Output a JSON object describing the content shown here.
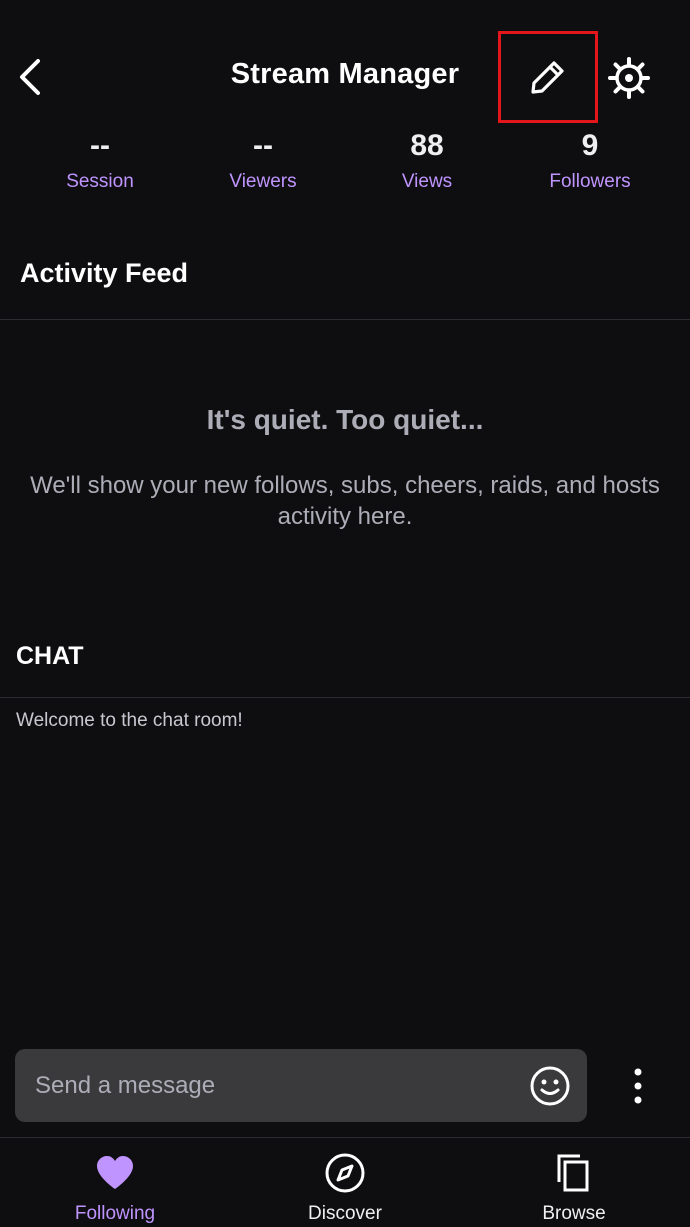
{
  "header": {
    "title": "Stream Manager"
  },
  "stats": [
    {
      "value": "--",
      "label": "Session"
    },
    {
      "value": "--",
      "label": "Viewers"
    },
    {
      "value": "88",
      "label": "Views"
    },
    {
      "value": "9",
      "label": "Followers"
    }
  ],
  "activity": {
    "title": "Activity Feed",
    "empty_title": "It's quiet. Too quiet...",
    "empty_description": "We'll show your new follows, subs, cheers, raids, and hosts activity here."
  },
  "chat": {
    "title": "CHAT",
    "welcome": "Welcome to the chat room!",
    "input_placeholder": "Send a message"
  },
  "nav": [
    {
      "label": "Following",
      "icon": "heart-icon",
      "active": true
    },
    {
      "label": "Discover",
      "icon": "compass-icon",
      "active": false
    },
    {
      "label": "Browse",
      "icon": "browse-icon",
      "active": false
    }
  ],
  "colors": {
    "background": "#0e0e10",
    "accent": "#bf94ff",
    "highlight_border": "#e3161c",
    "input_background": "#3a3a3d"
  }
}
